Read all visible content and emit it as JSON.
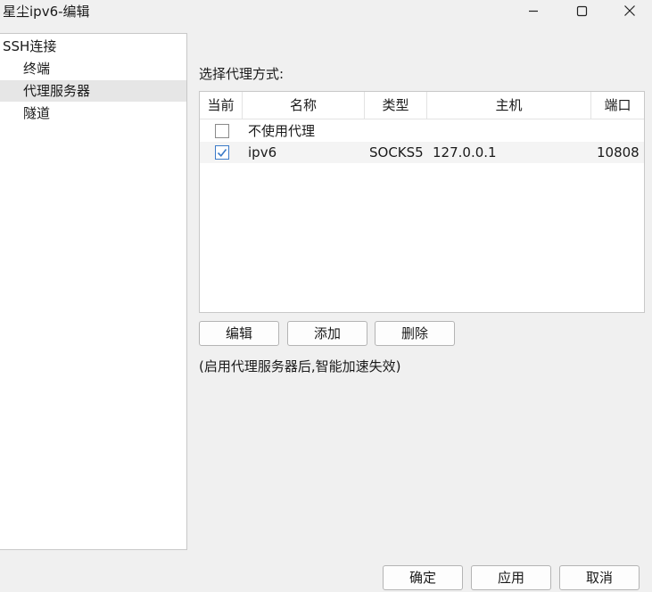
{
  "window": {
    "title": "星尘ipv6-编辑",
    "minimize_icon": "minimize-icon",
    "maximize_icon": "maximize-icon",
    "close_icon": "close-icon"
  },
  "sidebar": {
    "items": [
      {
        "label": "SSH连接",
        "level": 0,
        "selected": false
      },
      {
        "label": "终端",
        "level": 1,
        "selected": false
      },
      {
        "label": "代理服务器",
        "level": 1,
        "selected": true
      },
      {
        "label": "隧道",
        "level": 1,
        "selected": false
      }
    ]
  },
  "proxy": {
    "section_label": "选择代理方式:",
    "columns": [
      "当前",
      "名称",
      "类型",
      "主机",
      "端口"
    ],
    "rows": [
      {
        "current": false,
        "name": "不使用代理",
        "type": "",
        "host": "",
        "port": ""
      },
      {
        "current": true,
        "name": "ipv6",
        "type": "SOCKS5",
        "host": "127.0.0.1",
        "port": "10808"
      }
    ],
    "buttons": {
      "edit": "编辑",
      "add": "添加",
      "delete": "删除"
    },
    "hint": "(启用代理服务器后,智能加速失效)"
  },
  "footer": {
    "ok": "确定",
    "apply": "应用",
    "cancel": "取消"
  },
  "colors": {
    "check_accent": "#3b7ac8",
    "selected_bg": "#e6e6e6"
  }
}
